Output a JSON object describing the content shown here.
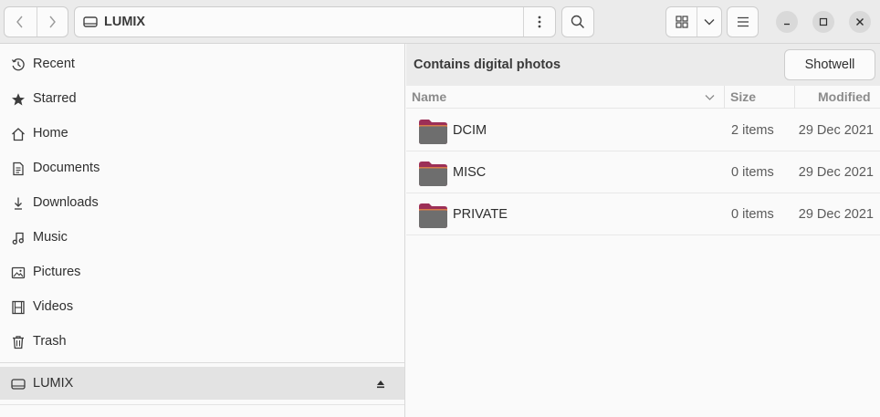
{
  "header": {
    "location_label": "LUMIX",
    "back_icon": "chevron-left-icon",
    "forward_icon": "chevron-right-icon",
    "search_icon": "search-icon",
    "view_icon": "grid-view-icon",
    "menu_icon": "hamburger-icon"
  },
  "sidebar": {
    "items": [
      {
        "label": "Recent",
        "icon": "clock-icon"
      },
      {
        "label": "Starred",
        "icon": "star-icon"
      },
      {
        "label": "Home",
        "icon": "home-icon"
      },
      {
        "label": "Documents",
        "icon": "document-icon"
      },
      {
        "label": "Downloads",
        "icon": "download-icon"
      },
      {
        "label": "Music",
        "icon": "music-icon"
      },
      {
        "label": "Pictures",
        "icon": "picture-icon"
      },
      {
        "label": "Videos",
        "icon": "video-icon"
      },
      {
        "label": "Trash",
        "icon": "trash-icon"
      }
    ],
    "devices": [
      {
        "label": "LUMIX",
        "icon": "drive-icon",
        "selected": true
      }
    ]
  },
  "infobar": {
    "message": "Contains digital photos",
    "action_label": "Shotwell"
  },
  "columns": {
    "name": "Name",
    "size": "Size",
    "modified": "Modified"
  },
  "files": [
    {
      "name": "DCIM",
      "size": "2 items",
      "modified": "29 Dec 2021"
    },
    {
      "name": "MISC",
      "size": "0 items",
      "modified": "29 Dec 2021"
    },
    {
      "name": "PRIVATE",
      "size": "0 items",
      "modified": "29 Dec 2021"
    }
  ],
  "colors": {
    "folder_body": "#6e6e6e",
    "folder_tab": "#9c2f57",
    "folder_stripe": "#d97b4a"
  }
}
